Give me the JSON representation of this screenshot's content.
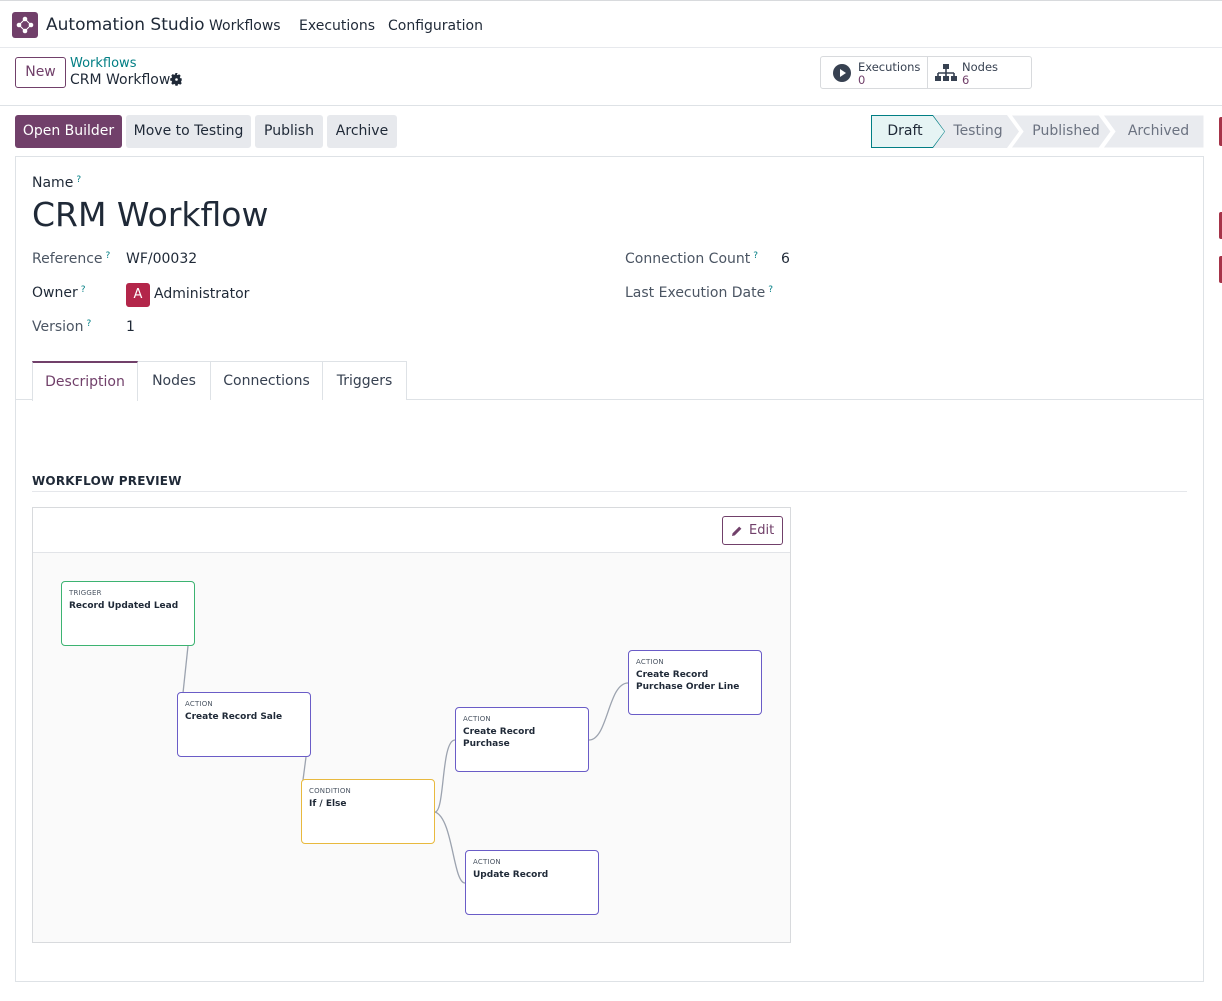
{
  "navbar": {
    "app_name": "Automation Studio",
    "menu": [
      "Workflows",
      "Executions",
      "Configuration"
    ]
  },
  "control": {
    "new_label": "New",
    "breadcrumb_parent": "Workflows",
    "breadcrumb_current": "CRM Workflow",
    "stats": [
      {
        "label": "Executions",
        "value": "0",
        "icon": "play-circle-icon"
      },
      {
        "label": "Nodes",
        "value": "6",
        "icon": "sitemap-icon"
      }
    ]
  },
  "actions": {
    "open_builder": "Open Builder",
    "move_to_testing": "Move to Testing",
    "publish": "Publish",
    "archive": "Archive"
  },
  "status": {
    "stages": [
      "Draft",
      "Testing",
      "Published",
      "Archived"
    ],
    "current": "Draft"
  },
  "form": {
    "name_label": "Name",
    "name_value": "CRM Workflow",
    "reference_label": "Reference",
    "reference_value": "WF/00032",
    "owner_label": "Owner",
    "owner_initial": "A",
    "owner_value": "Administrator",
    "version_label": "Version",
    "version_value": "1",
    "connection_count_label": "Connection Count",
    "connection_count_value": "6",
    "last_execution_label": "Last Execution Date",
    "last_execution_value": "",
    "help_mark": "?"
  },
  "tabs": [
    "Description",
    "Nodes",
    "Connections",
    "Triggers"
  ],
  "preview": {
    "section_title": "WORKFLOW PREVIEW",
    "edit_label": "Edit",
    "nodes": [
      {
        "kind": "TRIGGER",
        "name": "Record Updated Lead"
      },
      {
        "kind": "ACTION",
        "name": "Create Record Sale"
      },
      {
        "kind": "CONDITION",
        "name": "If / Else"
      },
      {
        "kind": "ACTION",
        "name": "Create Record Purchase"
      },
      {
        "kind": "ACTION",
        "name": "Create Record Purchase Order Line"
      },
      {
        "kind": "ACTION",
        "name": "Update Record"
      }
    ]
  },
  "colors": {
    "brand": "#71406a",
    "link": "#017e84",
    "trigger": "#3cb371",
    "action": "#6a5cc7",
    "condition": "#e8b93e"
  }
}
